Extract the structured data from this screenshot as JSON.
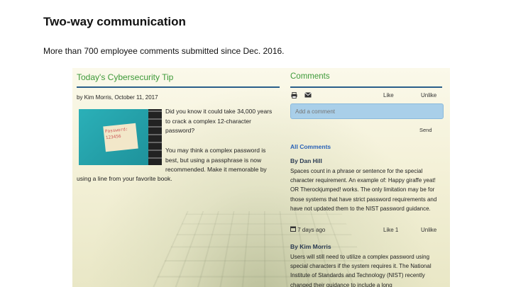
{
  "slide": {
    "title": "Two-way communication",
    "subtitle": "More than 700 employee comments submitted since Dec. 2016."
  },
  "tip": {
    "title": "Today's Cybersecurity Tip",
    "byline": "by Kim Morris, October 11, 2017",
    "image_text_line1": "Password:",
    "image_text_line2": "123456",
    "body1": "Did you know it could take 34,000 years to crack a complex 12-character password?",
    "body2": "You may think a complex password is best, but using a passphrase is now recommended. Make it memorable by",
    "body2_tail": "using a line from your favorite book."
  },
  "comments": {
    "title": "Comments",
    "print_icon": "printer-icon",
    "mail_icon": "mail-icon",
    "like_label": "Like",
    "unlike_label": "Unlike",
    "placeholder": "Add a comment",
    "send_label": "Send",
    "all_comments_label": "All Comments",
    "items": [
      {
        "author": "By Dan Hill",
        "body": "Spaces count in a phrase or sentence for the special character requirement. An example of: Happy giraffe yeat! OR Therockjumped! works. The only limitation may be for those systems that have strict password requirements and have not updated them to the NIST password guidance.",
        "age": "7 days ago",
        "like": "Like 1",
        "unlike": "Unlike"
      },
      {
        "author": "By Kim Morris",
        "body": "Users will still need to utilize a complex password using special characters if the system requires it. The National Institute of Standards and Technology (NIST) recently changed their guidance to include a long"
      }
    ]
  },
  "colors": {
    "accent_green": "#3e9a3a",
    "rule_blue": "#2a5f8a",
    "comment_box": "#a9cfe9",
    "link_blue": "#2a62b8"
  }
}
